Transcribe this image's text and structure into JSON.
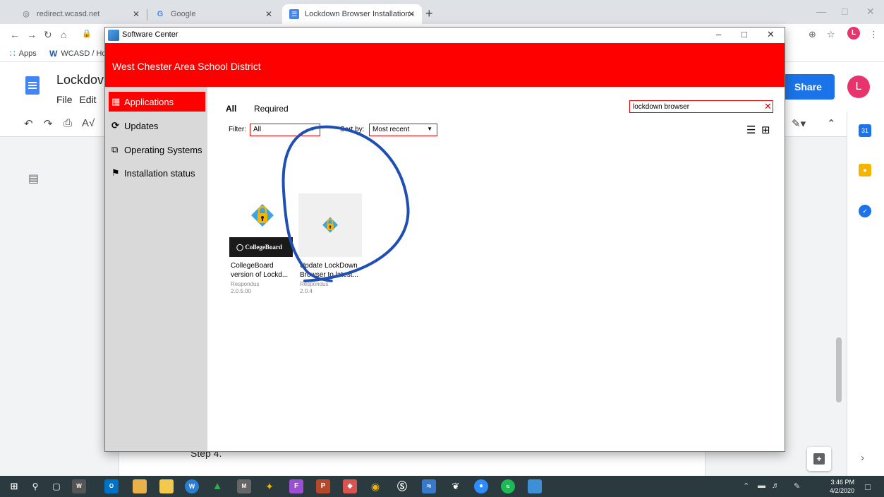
{
  "browser": {
    "tabs": [
      {
        "label": "redirect.wcasd.net"
      },
      {
        "label": "Google"
      },
      {
        "label": "Lockdown Browser Installation -"
      }
    ],
    "bookmarks": [
      {
        "label": "Apps"
      },
      {
        "label": "WCASD / Ho"
      }
    ]
  },
  "docs": {
    "title": "Lockdov",
    "menu": "File  Edit",
    "share_label": "Share",
    "avatar_initial": "L",
    "step_text": "Step 4."
  },
  "software_center": {
    "window_title": "Software Center",
    "org_name": "West Chester Area School District",
    "nav": [
      {
        "label": "Applications",
        "icon": "grid-icon"
      },
      {
        "label": "Updates",
        "icon": "refresh-icon"
      },
      {
        "label": "Operating Systems",
        "icon": "windows-icon"
      },
      {
        "label": "Installation status",
        "icon": "flag-icon"
      }
    ],
    "tabs": [
      {
        "label": "All"
      },
      {
        "label": "Required"
      }
    ],
    "filter_label": "Filter:",
    "filter_value": "All",
    "sort_label": "Sort by:",
    "sort_value": "Most recent",
    "search_value": "lockdown browser",
    "apps": [
      {
        "name": "CollegeBoard version of Lockd...",
        "publisher": "Respondus",
        "version": "2.0.5.00",
        "banner": "CollegeBoard"
      },
      {
        "name": "Update LockDown Browser to latest...",
        "publisher": "Respondus",
        "version": "2.0.4"
      }
    ]
  },
  "taskbar": {
    "time": "3:46 PM",
    "date": "4/2/2020"
  },
  "colors": {
    "brand_red": "#ff0000",
    "annotation_blue": "#1f4fb5"
  }
}
